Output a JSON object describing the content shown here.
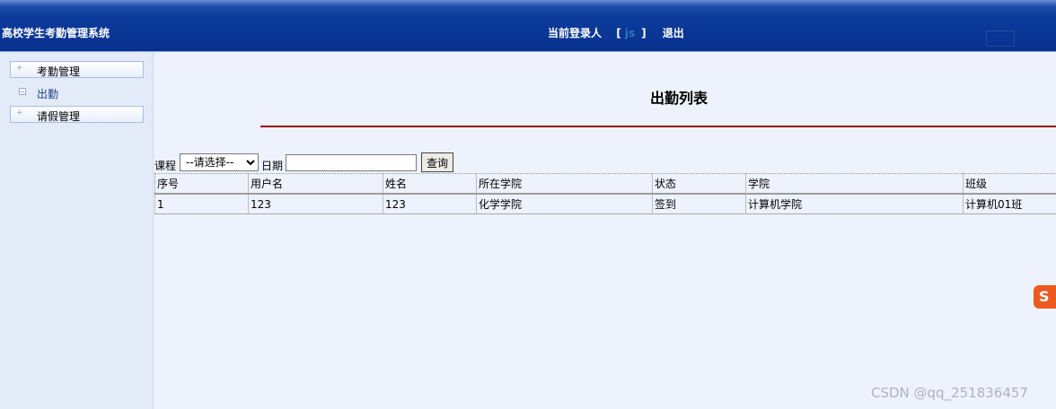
{
  "header": {
    "app_title": "高校学生考勤管理系统",
    "current_user_label": "当前登录人",
    "bracket_open": "[",
    "user_name": "js",
    "bracket_close": "]",
    "logout_label": "退出"
  },
  "sidebar": {
    "items": [
      {
        "type": "group",
        "label": "考勤管理",
        "icon": "plus-icon"
      },
      {
        "type": "leaf",
        "label": "出勤",
        "icon": "minus-box-icon"
      },
      {
        "type": "group",
        "label": "请假管理",
        "icon": "plus-icon"
      }
    ]
  },
  "main": {
    "title": "出勤列表",
    "search": {
      "course_label": "课程",
      "course_selected": "--请选择--",
      "date_label": "日期",
      "date_value": "",
      "query_button": "查询"
    },
    "table": {
      "columns": [
        "序号",
        "用户名",
        "姓名",
        "所在学院",
        "状态",
        "学院",
        "班级"
      ],
      "rows": [
        [
          "1",
          "123",
          "123",
          "化学学院",
          "签到",
          "计算机学院",
          "计算机01班"
        ]
      ]
    }
  },
  "overlay": {
    "ime_icon_letter": "S",
    "watermark": "CSDN @qq_251836457"
  },
  "colors": {
    "header_bg": "#07318f",
    "title_rule": "#990000",
    "sidebar_bg": "#e3ebf8",
    "main_bg": "#eef2fc"
  }
}
